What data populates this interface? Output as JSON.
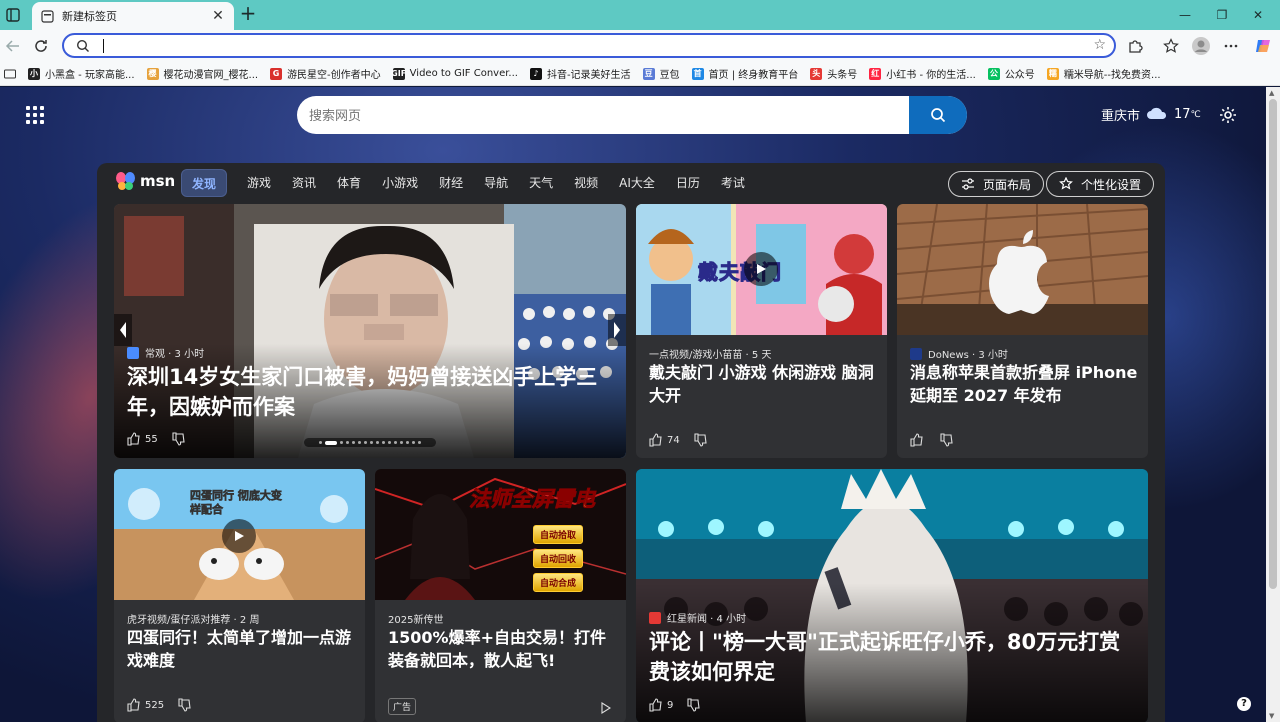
{
  "tab": {
    "title": "新建标签页",
    "close": "✕",
    "new": "+"
  },
  "window": {
    "minimize": "—",
    "restore": "❐",
    "close": "✕"
  },
  "address": {
    "value": "",
    "placeholder": ""
  },
  "bookmarks": [
    {
      "label": "小黑盒 - 玩家高能...",
      "color": "#222222",
      "glyph": "小"
    },
    {
      "label": "樱花动漫官网_樱花...",
      "color": "#e6a23c",
      "glyph": "樱"
    },
    {
      "label": "游民星空-创作者中心",
      "color": "#d9302c",
      "glyph": "G"
    },
    {
      "label": "Video to GIF Conver...",
      "color": "#222222",
      "glyph": "GIF"
    },
    {
      "label": "抖音-记录美好生活",
      "color": "#111111",
      "glyph": "♪"
    },
    {
      "label": "豆包",
      "color": "#5a7bd6",
      "glyph": "豆"
    },
    {
      "label": "首页 | 终身教育平台",
      "color": "#1e88e5",
      "glyph": "首"
    },
    {
      "label": "头条号",
      "color": "#e53935",
      "glyph": "头"
    },
    {
      "label": "小红书 - 你的生活...",
      "color": "#ff2442",
      "glyph": "红"
    },
    {
      "label": "公众号",
      "color": "#07c160",
      "glyph": "公"
    },
    {
      "label": "糯米导航--找免费资...",
      "color": "#f5a623",
      "glyph": "糯"
    }
  ],
  "search": {
    "placeholder": "搜索网页"
  },
  "weather": {
    "city": "重庆市",
    "temp": "17",
    "unit": "℃"
  },
  "msn": {
    "brand": "msn",
    "nav": [
      "发现",
      "游戏",
      "资讯",
      "体育",
      "小游戏",
      "财经",
      "导航",
      "天气",
      "视频",
      "AI大全",
      "日历",
      "考试"
    ],
    "layout_button": "页面布局",
    "personalize_button": "个性化设置"
  },
  "cards": {
    "hero": {
      "source": "常观 · 3 小时",
      "headline": "深圳14岁女生家门口被害，妈妈曾接送凶手上学三年，因嫉妒而作案",
      "likes": "55"
    },
    "game1": {
      "source": "一点视频/游戏小苗苗 · 5 天",
      "headline": "戴夫敲门 小游戏 休闲游戏 脑洞大开",
      "likes": "74",
      "img_text": "戴夫敲门"
    },
    "apple": {
      "source": "DoNews · 3 小时",
      "headline": "消息称苹果首款折叠屏 iPhone 延期至 2027 年发布"
    },
    "game2": {
      "source": "虎牙视频/蛋仔派对推荐 · 2 周",
      "headline": "四蛋同行！太简单了增加一点游戏难度",
      "likes": "525",
      "img_text": "四蛋同行 彻底大变样配合"
    },
    "ad": {
      "source": "2025新传世",
      "headline": "1500%爆率+自由交易！打件装备就回本，散人起飞!",
      "ad_label": "广告",
      "img_title": "法师全屏雷电",
      "img_btns": [
        "自动拾取",
        "自动回收",
        "自动合成"
      ]
    },
    "big": {
      "source": "红星新闻 · 4 小时",
      "headline": "评论丨\"榜一大哥\"正式起诉旺仔小乔，80万元打赏费该如何界定",
      "likes": "9"
    }
  },
  "help": "?"
}
